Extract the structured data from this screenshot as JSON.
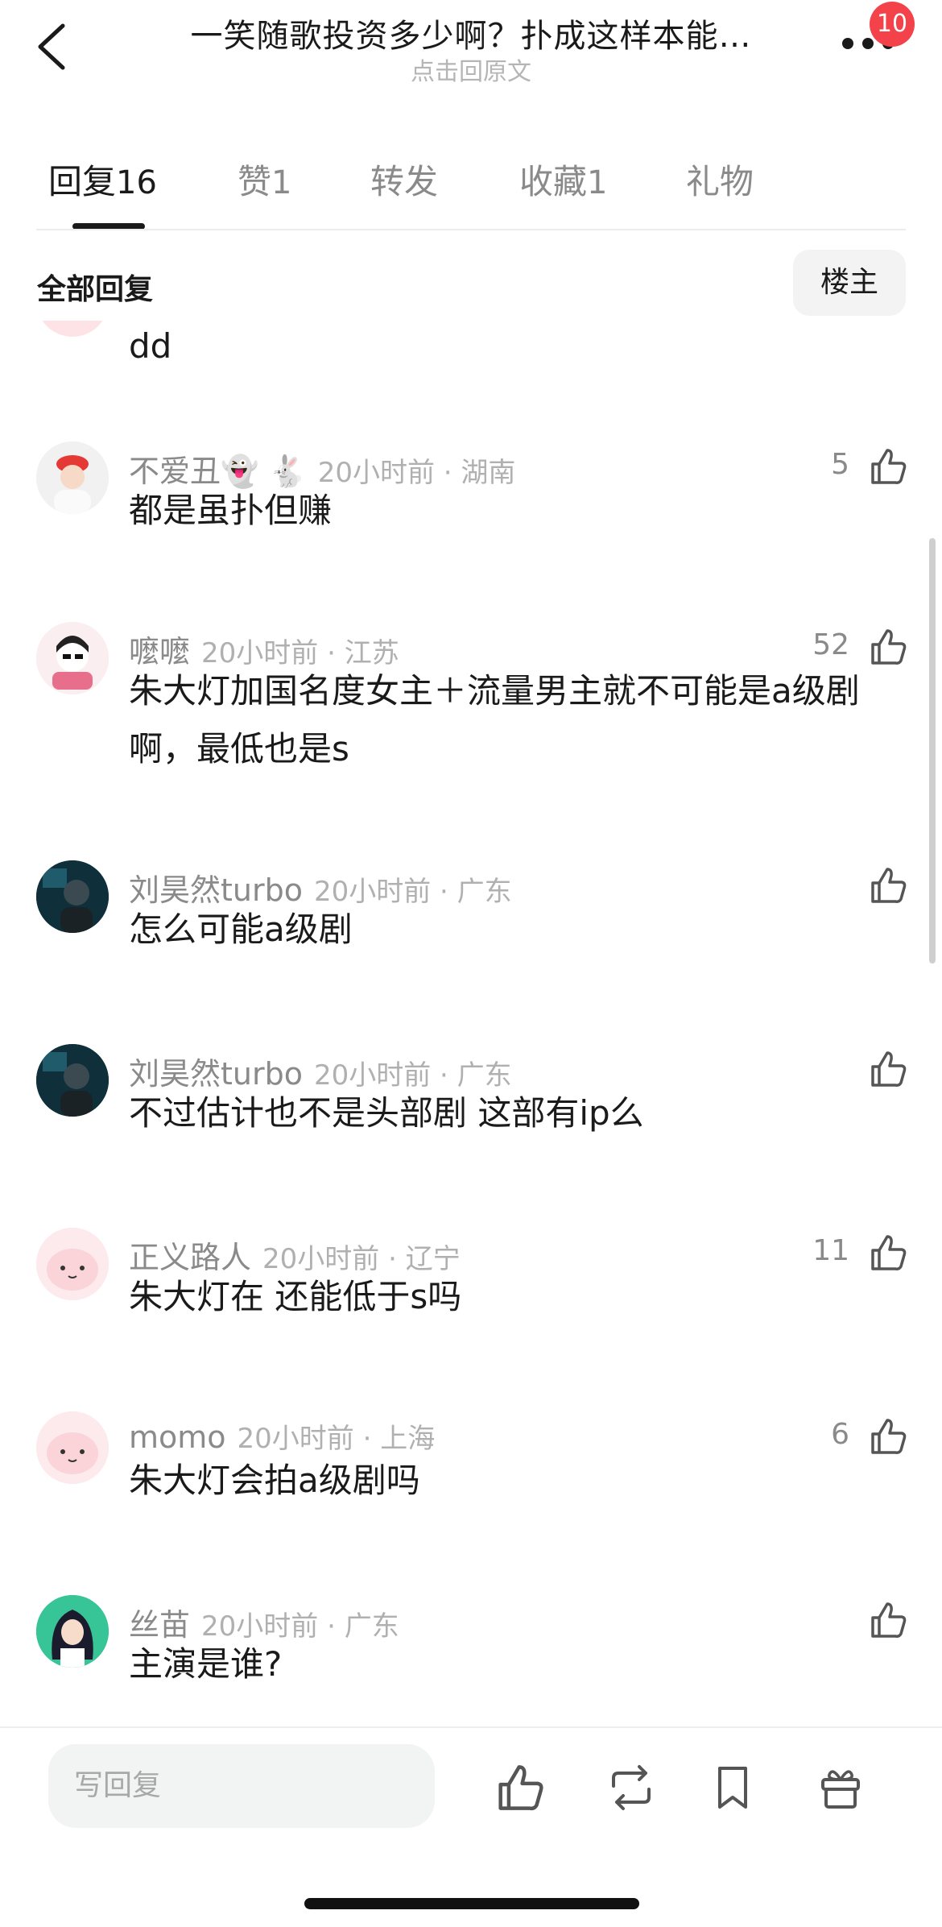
{
  "header": {
    "title": "一笑随歌投资多少啊？扑成这样本能…",
    "subtitle": "点击回原文",
    "badge": "10"
  },
  "tabs": [
    {
      "label": "回复",
      "count": "16"
    },
    {
      "label": "赞",
      "count": "1"
    },
    {
      "label": "转发",
      "count": ""
    },
    {
      "label": "收藏",
      "count": "1"
    },
    {
      "label": "礼物",
      "count": ""
    }
  ],
  "filter": {
    "all_label": "全部回复",
    "owner_label": "楼主"
  },
  "comments": [
    {
      "name": "",
      "meta": "",
      "content": "dd",
      "likes": ""
    },
    {
      "name": "不爱丑👻 🐇",
      "meta": "20小时前 · 湖南",
      "content": "都是虽扑但赚",
      "likes": "5"
    },
    {
      "name": "嚒嚒",
      "meta": "20小时前 · 江苏",
      "content": "朱大灯加国名度女主＋流量男主就不可能是a级剧啊，最低也是s",
      "likes": "52"
    },
    {
      "name": "刘昊然turbo",
      "meta": "20小时前 · 广东",
      "content": "怎么可能a级剧",
      "likes": ""
    },
    {
      "name": "刘昊然turbo",
      "meta": "20小时前 · 广东",
      "content": "不过估计也不是头部剧 这部有ip么",
      "likes": ""
    },
    {
      "name": "正义路人",
      "meta": "20小时前 · 辽宁",
      "content": "朱大灯在 还能低于s吗",
      "likes": "11"
    },
    {
      "name": "momo",
      "meta": "20小时前 · 上海",
      "content": "朱大灯会拍a级剧吗",
      "likes": "6"
    },
    {
      "name": "丝苗",
      "meta": "20小时前 · 广东",
      "content": "主演是谁?",
      "likes": ""
    }
  ],
  "bottom_bar": {
    "input_placeholder": "写回复"
  }
}
